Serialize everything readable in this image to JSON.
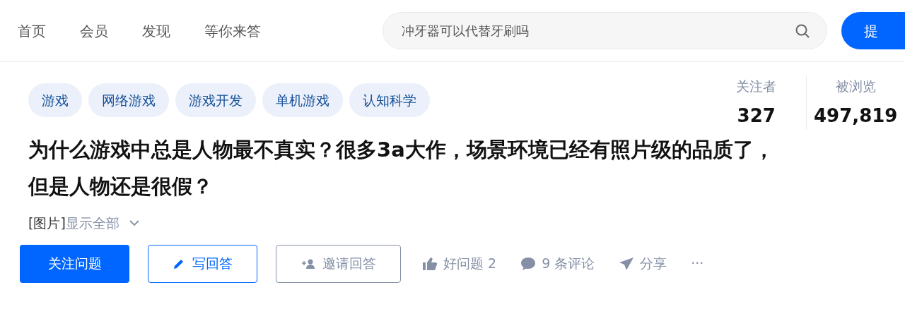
{
  "nav": [
    "首页",
    "会员",
    "发现",
    "等你来答"
  ],
  "search": {
    "value": "冲牙器可以代替牙刷吗"
  },
  "ask_button": "提",
  "tags": [
    "游戏",
    "网络游戏",
    "游戏开发",
    "单机游戏",
    "认知科学"
  ],
  "stats": [
    {
      "label": "关注者",
      "value": "327"
    },
    {
      "label": "被浏览",
      "value": "497,819"
    }
  ],
  "title": "为什么游戏中总是人物最不真实？很多3a大作，场景环境已经有照片级的品质了，但是人物还是很假？",
  "excerpt": "[图片]",
  "show_all": "显示全部",
  "buttons": [
    {
      "kind": "primary",
      "label": "关注问题"
    },
    {
      "kind": "outline",
      "label": "写回答"
    },
    {
      "kind": "plain",
      "label": "邀请回答"
    }
  ],
  "actions": [
    {
      "kind": "like",
      "label": "好问题 2"
    },
    {
      "kind": "comment",
      "label": "9 条评论"
    },
    {
      "kind": "share",
      "label": "分享"
    },
    {
      "kind": "more",
      "label": "···"
    }
  ]
}
